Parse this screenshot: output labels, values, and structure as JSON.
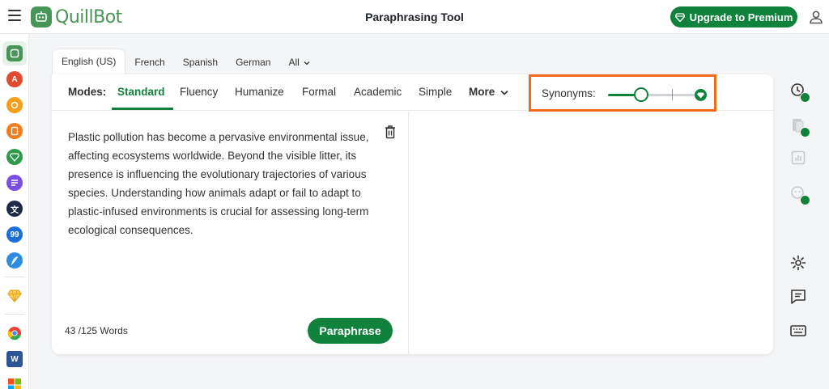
{
  "header": {
    "brand": "QuillBot",
    "title": "Paraphrasing Tool",
    "upgrade_label": "Upgrade to Premium"
  },
  "left_rail": {
    "items": [
      {
        "icon": "paraphraser-icon",
        "color": "#499557"
      },
      {
        "icon": "grammar-checker-icon",
        "color": "#e24a2f"
      },
      {
        "icon": "ai-detector-icon",
        "color": "#f59e1b"
      },
      {
        "icon": "plagiarism-checker-icon",
        "color": "#f27b1c"
      },
      {
        "icon": "ai-humanizer-icon",
        "color": "#2e9a4b"
      },
      {
        "icon": "summarizer-icon",
        "color": "#7a4ee0"
      },
      {
        "icon": "translator-icon",
        "color": "#1f2b46"
      },
      {
        "icon": "citation-generator-icon",
        "color": "#1c6fd8"
      },
      {
        "icon": "quillbot-flow-icon",
        "color": "#2d8be0"
      },
      {
        "icon": "premium-diamond-icon",
        "color": "#f5b233"
      },
      {
        "icon": "chrome-extension-icon",
        "color": "#ea4335"
      },
      {
        "icon": "word-addin-icon",
        "color": "#2b5797"
      },
      {
        "icon": "windows-app-icon",
        "color": "#f25022"
      }
    ]
  },
  "languages": {
    "tabs": [
      "English (US)",
      "French",
      "Spanish",
      "German"
    ],
    "all_label": "All"
  },
  "modes": {
    "label": "Modes:",
    "items": [
      "Standard",
      "Fluency",
      "Humanize",
      "Formal",
      "Academic",
      "Simple"
    ],
    "more_label": "More",
    "active": "Standard"
  },
  "synonyms": {
    "label": "Synonyms:",
    "level_fraction": 0.4
  },
  "input": {
    "text": "Plastic pollution has become a pervasive environmental issue, affecting ecosystems worldwide. Beyond the visible litter, its presence is influencing the evolutionary trajectories of various species. Understanding how animals adapt or fail to adapt to plastic-infused environments is crucial for assessing long-term ecological consequences.",
    "word_count": "43 /125 Words"
  },
  "actions": {
    "paraphrase_label": "Paraphrase"
  },
  "colors": {
    "brand_green": "#11823b",
    "logo_green": "#499557",
    "highlight_orange": "#f26b1d"
  }
}
